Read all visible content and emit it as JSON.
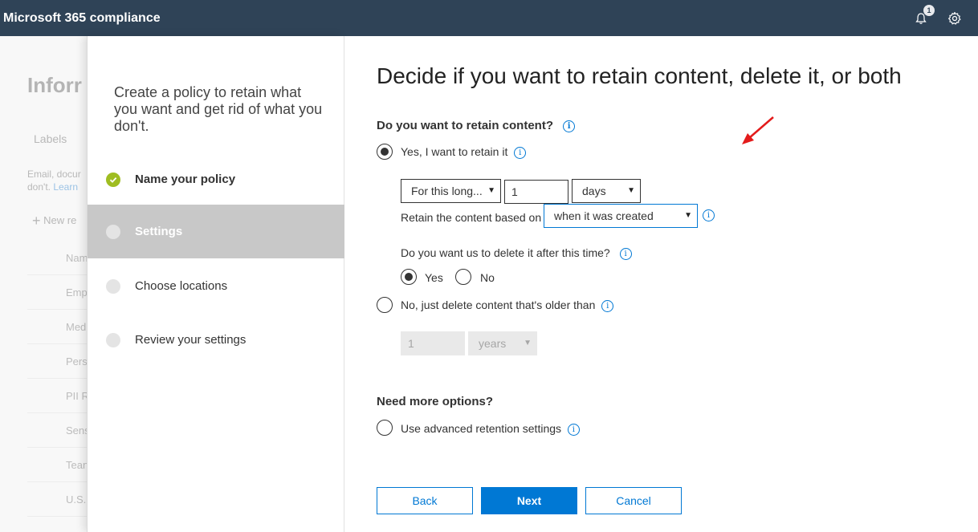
{
  "topbar": {
    "app_title": "Microsoft 365 compliance",
    "notification_count": "1",
    "icons": [
      "bell-icon",
      "gear-icon"
    ]
  },
  "background": {
    "title": "Inforr",
    "tab": "Labels",
    "desc_line1": "Email, docur",
    "desc_line2": "don't.",
    "desc_link": "Learn",
    "new_button": "New re",
    "rows": [
      "Nam",
      "Emp",
      "Med",
      "Pers",
      "PII R",
      "Sens",
      "Tean",
      "U.S."
    ]
  },
  "wizard": {
    "intro": "Create a policy to retain what you want and get rid of what you don't.",
    "steps": [
      {
        "label": "Name your policy",
        "state": "done"
      },
      {
        "label": "Settings",
        "state": "active"
      },
      {
        "label": "Choose locations",
        "state": "pending"
      },
      {
        "label": "Review your settings",
        "state": "pending"
      }
    ]
  },
  "main": {
    "heading": "Decide if you want to retain content, delete it, or both",
    "retain_question": "Do you want to retain content?",
    "retain_yes_label": "Yes, I want to retain it",
    "retain_period": "For this long...",
    "retain_amount": "1",
    "retain_unit": "days",
    "retain_based_on_label": "Retain the content based on",
    "retain_based_on_value": "when it was created",
    "delete_question": "Do you want us to delete it after this time?",
    "delete_yes": "Yes",
    "delete_no": "No",
    "retain_no_label": "No, just delete content that's older than",
    "delete_amount": "1",
    "delete_unit": "years",
    "more_options_heading": "Need more options?",
    "advanced_label": "Use advanced retention settings",
    "buttons": {
      "back": "Back",
      "next": "Next",
      "cancel": "Cancel"
    }
  },
  "colors": {
    "topbar": "#2f4357",
    "accent": "#0078d4",
    "step_done": "#9fbd21",
    "step_active_bg": "#c8c8c8",
    "annotation_arrow": "#e31b1b"
  }
}
